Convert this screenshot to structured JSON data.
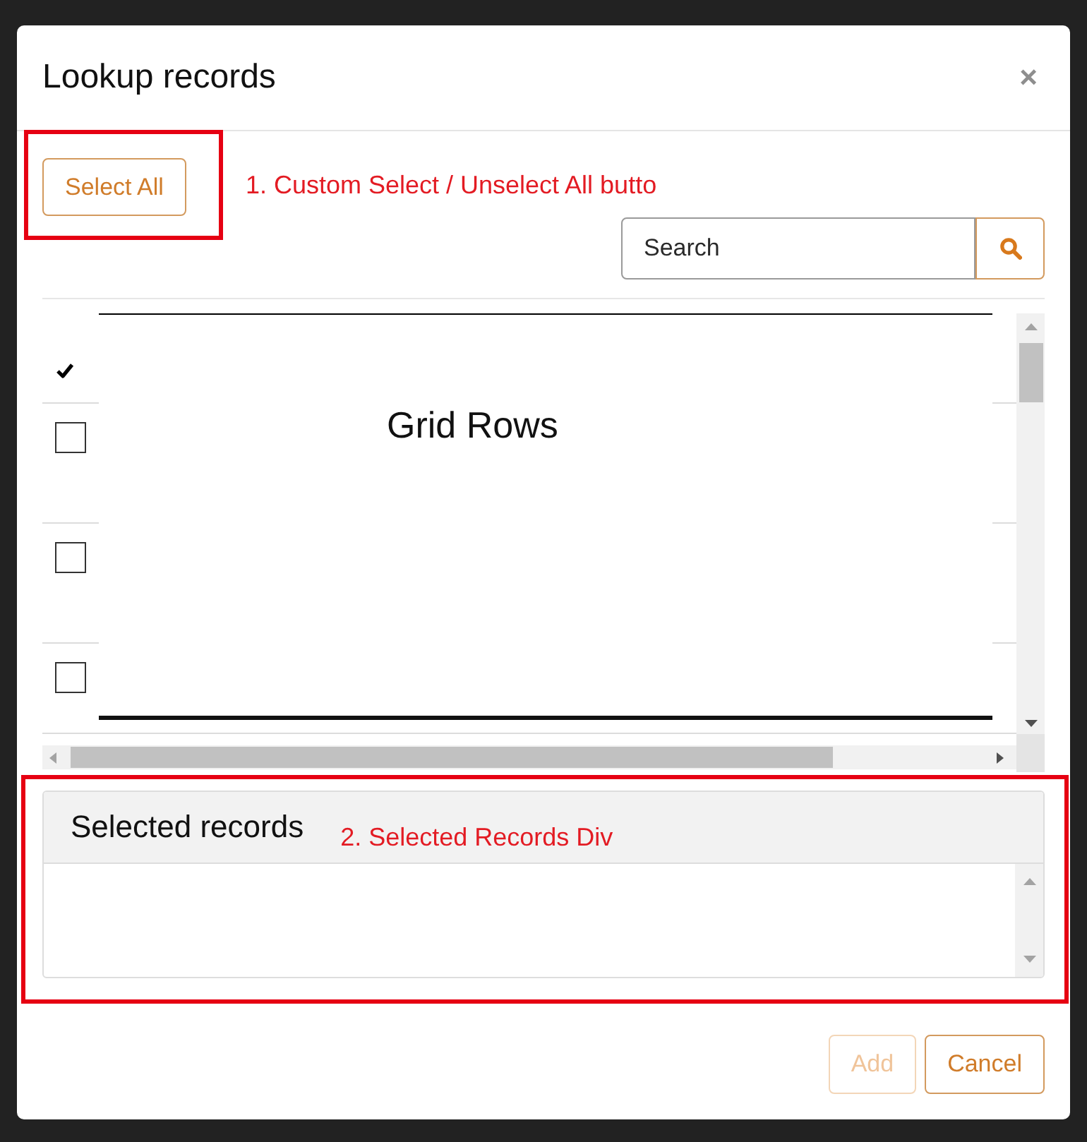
{
  "dialog": {
    "title": "Lookup records",
    "close_label": "×"
  },
  "toolbar": {
    "select_all": {
      "label": "Select All"
    },
    "annotation": {
      "label": "1. Custom Select / Unselect All butto"
    },
    "search": {
      "placeholder": "Search"
    }
  },
  "grid": {
    "overlay_label": "Grid Rows",
    "rows": [
      {
        "checked": false
      },
      {
        "checked": false
      },
      {
        "checked": false
      }
    ]
  },
  "selected_records": {
    "title": "Selected records",
    "annotation": {
      "label": "2. Selected Records Div"
    }
  },
  "footer": {
    "buttons": [
      {
        "label": "Add",
        "disabled": true
      },
      {
        "label": "Cancel",
        "disabled": false
      }
    ]
  }
}
